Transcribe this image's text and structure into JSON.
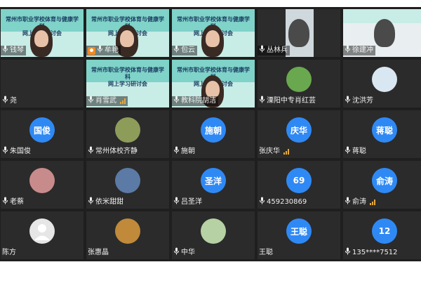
{
  "slide": {
    "title_line1": "常州市职业学校体育与健康学科",
    "title_line2": "网上学习研讨会"
  },
  "participants": [
    {
      "name": "钱琴",
      "type": "video",
      "mic": "on"
    },
    {
      "name": "牟艳",
      "type": "video",
      "mic": "on",
      "host": true
    },
    {
      "name": "包云",
      "type": "video",
      "mic": "on"
    },
    {
      "name": "丛林兵",
      "type": "video",
      "mic": "on"
    },
    {
      "name": "徐建冲",
      "type": "video",
      "mic": "on"
    },
    {
      "name": "尧",
      "type": "blank",
      "mic": "on"
    },
    {
      "name": "肖雪武",
      "type": "video",
      "mic": "on",
      "signal": true
    },
    {
      "name": "教科院胡洁",
      "type": "video",
      "mic": "on",
      "active": true
    },
    {
      "name": "溧阳中专肖红芸",
      "type": "avatar-img",
      "mic": "on",
      "avatar_color": "#6aa84f"
    },
    {
      "name": "沈洪芳",
      "type": "avatar-img",
      "mic": "on",
      "avatar_color": "#d9e7f2"
    },
    {
      "name": "朱国俊",
      "type": "avatar",
      "mic": "on",
      "avatar_text": "国俊"
    },
    {
      "name": "常州体校齐静",
      "type": "avatar-img",
      "mic": "on",
      "avatar_color": "#8e9c5a"
    },
    {
      "name": "施朝",
      "type": "avatar",
      "mic": "on",
      "avatar_text": "施朝"
    },
    {
      "name": "张庆华",
      "type": "avatar",
      "mic": "none",
      "avatar_text": "庆华",
      "signal": true
    },
    {
      "name": "蒋聪",
      "type": "avatar",
      "mic": "on",
      "avatar_text": "蒋聪"
    },
    {
      "name": "老蔡",
      "type": "avatar-img",
      "mic": "on",
      "avatar_color": "#c88b8b"
    },
    {
      "name": "依米甜甜",
      "type": "avatar-img",
      "mic": "on",
      "avatar_color": "#5b7aa6"
    },
    {
      "name": "吕圣洋",
      "type": "avatar",
      "mic": "on",
      "avatar_text": "圣洋"
    },
    {
      "name": "459230869",
      "type": "avatar",
      "mic": "on",
      "avatar_text": "69"
    },
    {
      "name": "俞涛",
      "type": "avatar",
      "mic": "on",
      "avatar_text": "俞涛",
      "signal": true
    },
    {
      "name": "陈方",
      "type": "avatar-img",
      "mic": "none",
      "avatar_color": "#e6e6e6"
    },
    {
      "name": "张惠晶",
      "type": "avatar-img",
      "mic": "none",
      "avatar_color": "#c08a3a"
    },
    {
      "name": "中华",
      "type": "avatar-img",
      "mic": "on",
      "avatar_color": "#b6d1a3"
    },
    {
      "name": "王聪",
      "type": "avatar",
      "mic": "none",
      "avatar_text": "王聪"
    },
    {
      "name": "135****7512",
      "type": "avatar",
      "mic": "on",
      "avatar_text": "12"
    }
  ],
  "colors": {
    "background": "#1f1f1f",
    "tile": "#2b2b2b",
    "avatar_blue": "#2f89f5",
    "host_badge": "#f08a24",
    "signal": "#e9a83a",
    "active_border": "#3fbf5a"
  }
}
